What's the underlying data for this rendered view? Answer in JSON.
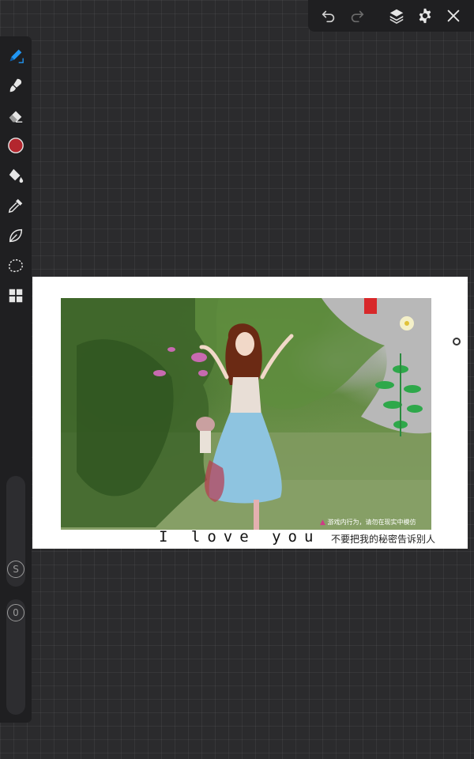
{
  "app": {
    "accent_color": "#2196f3",
    "brush_color": "#b3262e",
    "toolbar_bg": "#1f1f21"
  },
  "top_toolbar": {
    "icons": [
      "undo-icon",
      "redo-icon",
      "layers-icon",
      "gear-icon",
      "close-icon"
    ]
  },
  "left_toolbar": {
    "tools": [
      "pen-icon",
      "brush-icon",
      "eraser-icon",
      "color-swatch",
      "fill-bucket-icon",
      "eyedropper-icon",
      "leaf-icon",
      "lasso-icon",
      "grid-icon"
    ],
    "size_label": "S",
    "opacity_label": "0"
  },
  "canvas": {
    "watermark": "游戏内行为，请勿在现实中模仿",
    "caption_en": "I love you",
    "caption_cn": "不要把我的秘密告诉别人"
  }
}
